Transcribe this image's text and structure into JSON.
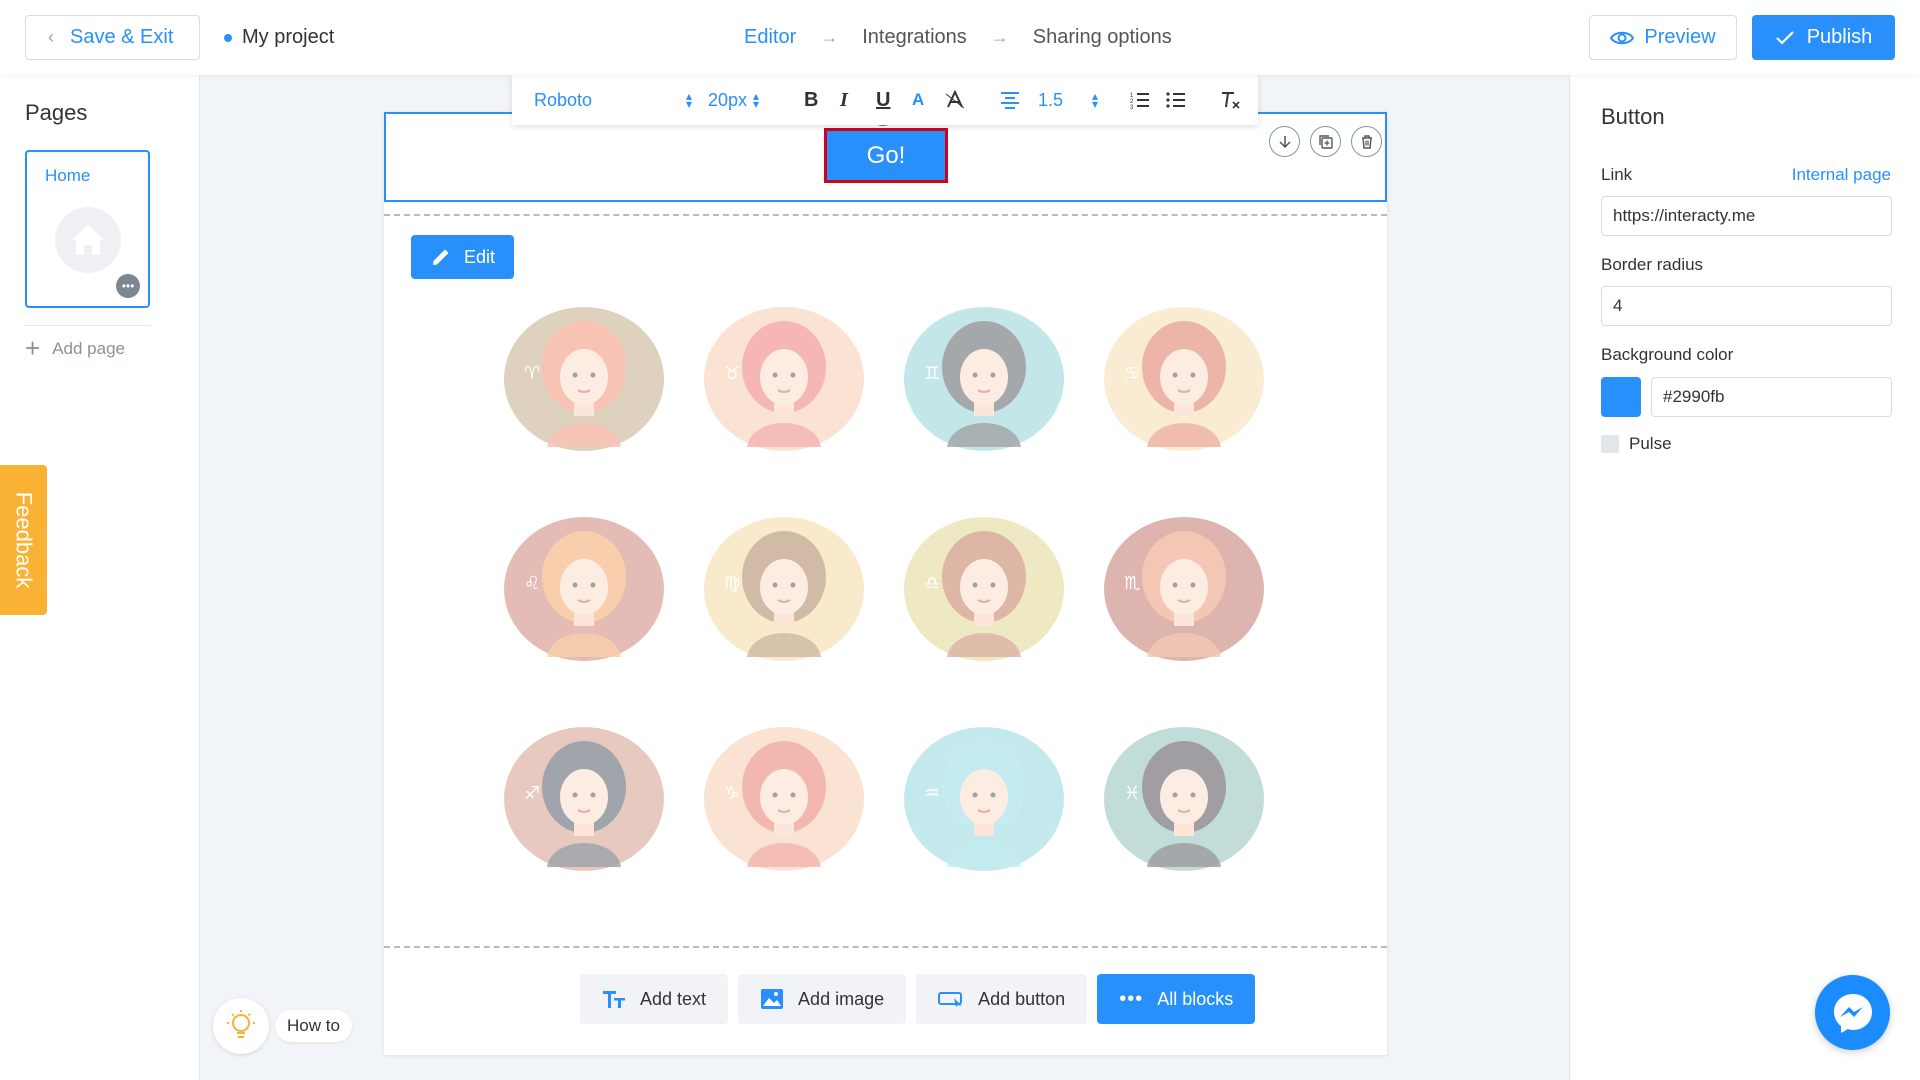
{
  "header": {
    "save_exit_label": "Save & Exit",
    "project_name": "My project",
    "steps": [
      {
        "label": "Editor",
        "active": true
      },
      {
        "label": "Integrations",
        "active": false
      },
      {
        "label": "Sharing options",
        "active": false
      }
    ],
    "preview_label": "Preview",
    "publish_label": "Publish"
  },
  "pages_panel": {
    "title": "Pages",
    "pages": [
      {
        "label": "Home"
      }
    ],
    "add_page_label": "Add page"
  },
  "feedback_label": "Feedback",
  "how_to_label": "How to",
  "toolbar": {
    "font": "Roboto",
    "size": "20px",
    "line_height": "1.5"
  },
  "canvas": {
    "button_text": "Go!",
    "edit_label": "Edit",
    "add_text_label": "Add text",
    "add_image_label": "Add image",
    "add_button_label": "Add button",
    "all_blocks_label": "All blocks",
    "avatars": [
      {
        "icon": "aries-avatar",
        "bg": "#b89a6e",
        "hair": "#f07a5c",
        "sign": "♈"
      },
      {
        "icon": "taurus-avatar",
        "bg": "#f6c39d",
        "hair": "#e9605a",
        "sign": "♉"
      },
      {
        "icon": "gemini-avatar",
        "bg": "#7ccbd0",
        "hair": "#3a3f45",
        "sign": "♊"
      },
      {
        "icon": "cancer-avatar",
        "bg": "#f3d79c",
        "hair": "#d95c3f",
        "sign": "♋"
      },
      {
        "icon": "leo-avatar",
        "bg": "#c46a5c",
        "hair": "#f2944b",
        "sign": "♌"
      },
      {
        "icon": "virgo-avatar",
        "bg": "#f1d18e",
        "hair": "#9a6a3c",
        "sign": "♍"
      },
      {
        "icon": "libra-avatar",
        "bg": "#ddd07c",
        "hair": "#b65e3c",
        "sign": "♎"
      },
      {
        "icon": "scorpio-avatar",
        "bg": "#b45a4e",
        "hair": "#e8855a",
        "sign": "♏"
      },
      {
        "icon": "sagittarius-avatar",
        "bg": "#cc8a76",
        "hair": "#2e3a4a",
        "sign": "♐"
      },
      {
        "icon": "capricorn-avatar",
        "bg": "#f6c39d",
        "hair": "#e4634f",
        "sign": "♑"
      },
      {
        "icon": "aquarius-avatar",
        "bg": "#7ed0d6",
        "hair": "#7ed3e0",
        "sign": "♒"
      },
      {
        "icon": "pisces-avatar",
        "bg": "#79b2ae",
        "hair": "#2e2a33",
        "sign": "♓"
      }
    ]
  },
  "right_panel": {
    "title": "Button",
    "link_label": "Link",
    "link_type": "Internal page",
    "link_value": "https://interacty.me",
    "border_radius_label": "Border radius",
    "border_radius_value": "4",
    "bg_color_label": "Background color",
    "bg_color_value": "#2990fb",
    "pulse_label": "Pulse"
  },
  "colors": {
    "accent": "#2990fb",
    "feedback": "#f9b233",
    "selection_border": "#d0021b",
    "messenger": "#1a8cfe"
  }
}
